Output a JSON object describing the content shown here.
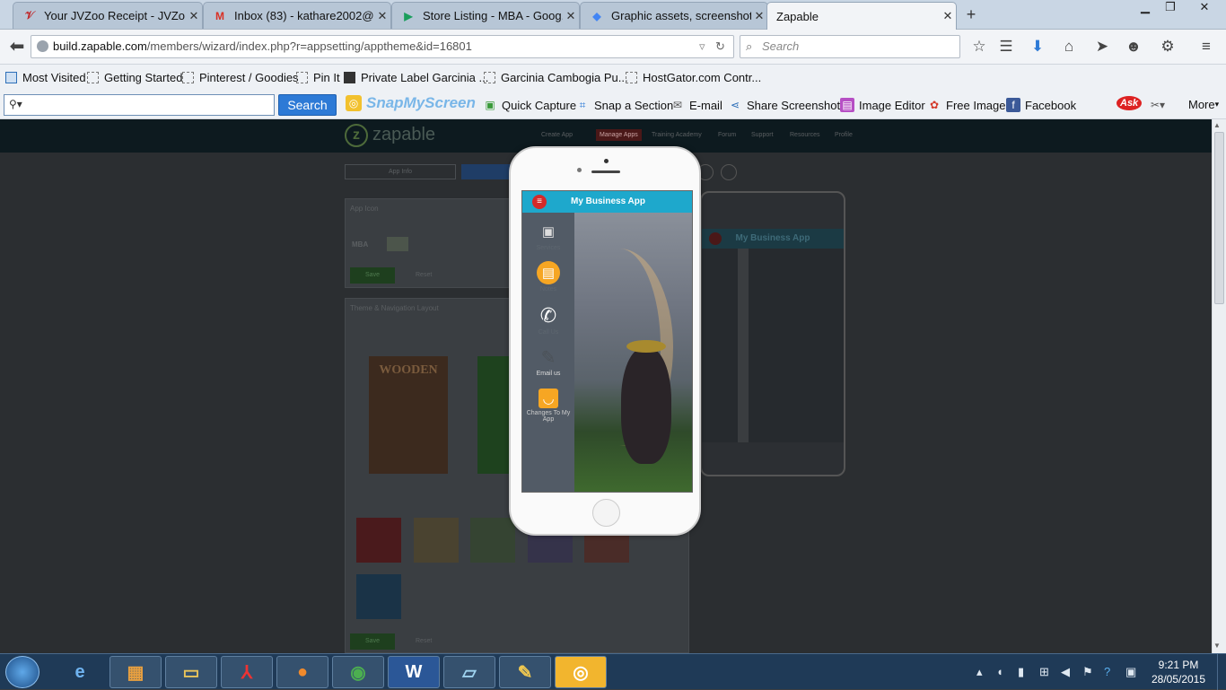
{
  "browser": {
    "tabs": [
      {
        "title": "Your JVZoo Receipt - JVZo...",
        "icon": "jvzoo-icon",
        "close": "✕"
      },
      {
        "title": "Inbox (83) - kathare2002@...",
        "icon": "gmail-icon",
        "close": "✕"
      },
      {
        "title": "Store Listing - MBA - Goog...",
        "icon": "google-play-icon",
        "close": "✕"
      },
      {
        "title": "Graphic assets, screenshots...",
        "icon": "google-icon",
        "close": "✕"
      },
      {
        "title": "Zapable",
        "icon": "none",
        "close": "✕"
      }
    ],
    "new_tab": "+",
    "url_host": "build.zapable.com",
    "url_path": "/members/wizard/index.php?r=appsetting/apptheme&id=16801",
    "search_placeholder": "Search"
  },
  "bookmarks": [
    {
      "label": "Most Visited",
      "icon": "gear-bookmark-icon"
    },
    {
      "label": "Getting Started",
      "icon": "page-icon"
    },
    {
      "label": "Pinterest / Goodies",
      "icon": "page-icon"
    },
    {
      "label": "Pin It",
      "icon": "page-icon"
    },
    {
      "label": "Private Label Garcinia ...",
      "icon": "label-icon"
    },
    {
      "label": "Garcinia Cambogia Pu...",
      "icon": "page-icon"
    },
    {
      "label": "HostGator.com Contr...",
      "icon": "page-icon"
    }
  ],
  "toolbar": {
    "search_button": "Search",
    "snapmyscreen": "SnapMyScreen",
    "items": [
      {
        "label": "Quick Capture",
        "icon": "camera-icon"
      },
      {
        "label": "Snap a Section",
        "icon": "crop-icon"
      },
      {
        "label": "E-mail",
        "icon": "mail-icon"
      },
      {
        "label": "Share Screenshots",
        "icon": "share-icon"
      },
      {
        "label": "Image Editor",
        "icon": "image-editor-icon"
      },
      {
        "label": "Free Images",
        "icon": "flower-icon"
      },
      {
        "label": "Facebook",
        "icon": "facebook-icon"
      }
    ],
    "ask": "Ask",
    "more": "More"
  },
  "site": {
    "logo": "zapable",
    "nav": [
      "Create App",
      "Manage Apps",
      "Training Academy",
      "Forum",
      "Support",
      "Resources",
      "Profile"
    ],
    "tab_app_info": "App Info",
    "app_icon_title": "App Icon",
    "mba": "MBA",
    "save": "Save",
    "reset": "Reset",
    "theme_title": "Theme & Navigation Layout",
    "wooden": "WOODEN"
  },
  "phone": {
    "app_title": "My Business App",
    "menu": [
      {
        "label": "Services",
        "icon": "camera-icon"
      },
      {
        "label": "Notes",
        "icon": "notes-icon"
      },
      {
        "label": "Call Us",
        "icon": "phone-icon"
      },
      {
        "label": "Email us",
        "icon": "feather-icon"
      },
      {
        "label": "Changes To My App",
        "icon": "bag-icon"
      }
    ]
  },
  "preview_phone": {
    "app_title": "My Business App"
  },
  "taskbar": {
    "time": "9:21 PM",
    "date": "28/05/2015",
    "apps": [
      "internet-explorer-icon",
      "gift-icon",
      "folder-icon",
      "acrobat-icon",
      "firefox-icon",
      "chrome-icon",
      "word-icon",
      "notepad-icon",
      "paint-icon",
      "snapmyscreen-icon"
    ]
  },
  "colors": {
    "app_bar": "#1ea8cc",
    "search_button": "#2d7ad6",
    "taskbar": "#1f3a57"
  }
}
